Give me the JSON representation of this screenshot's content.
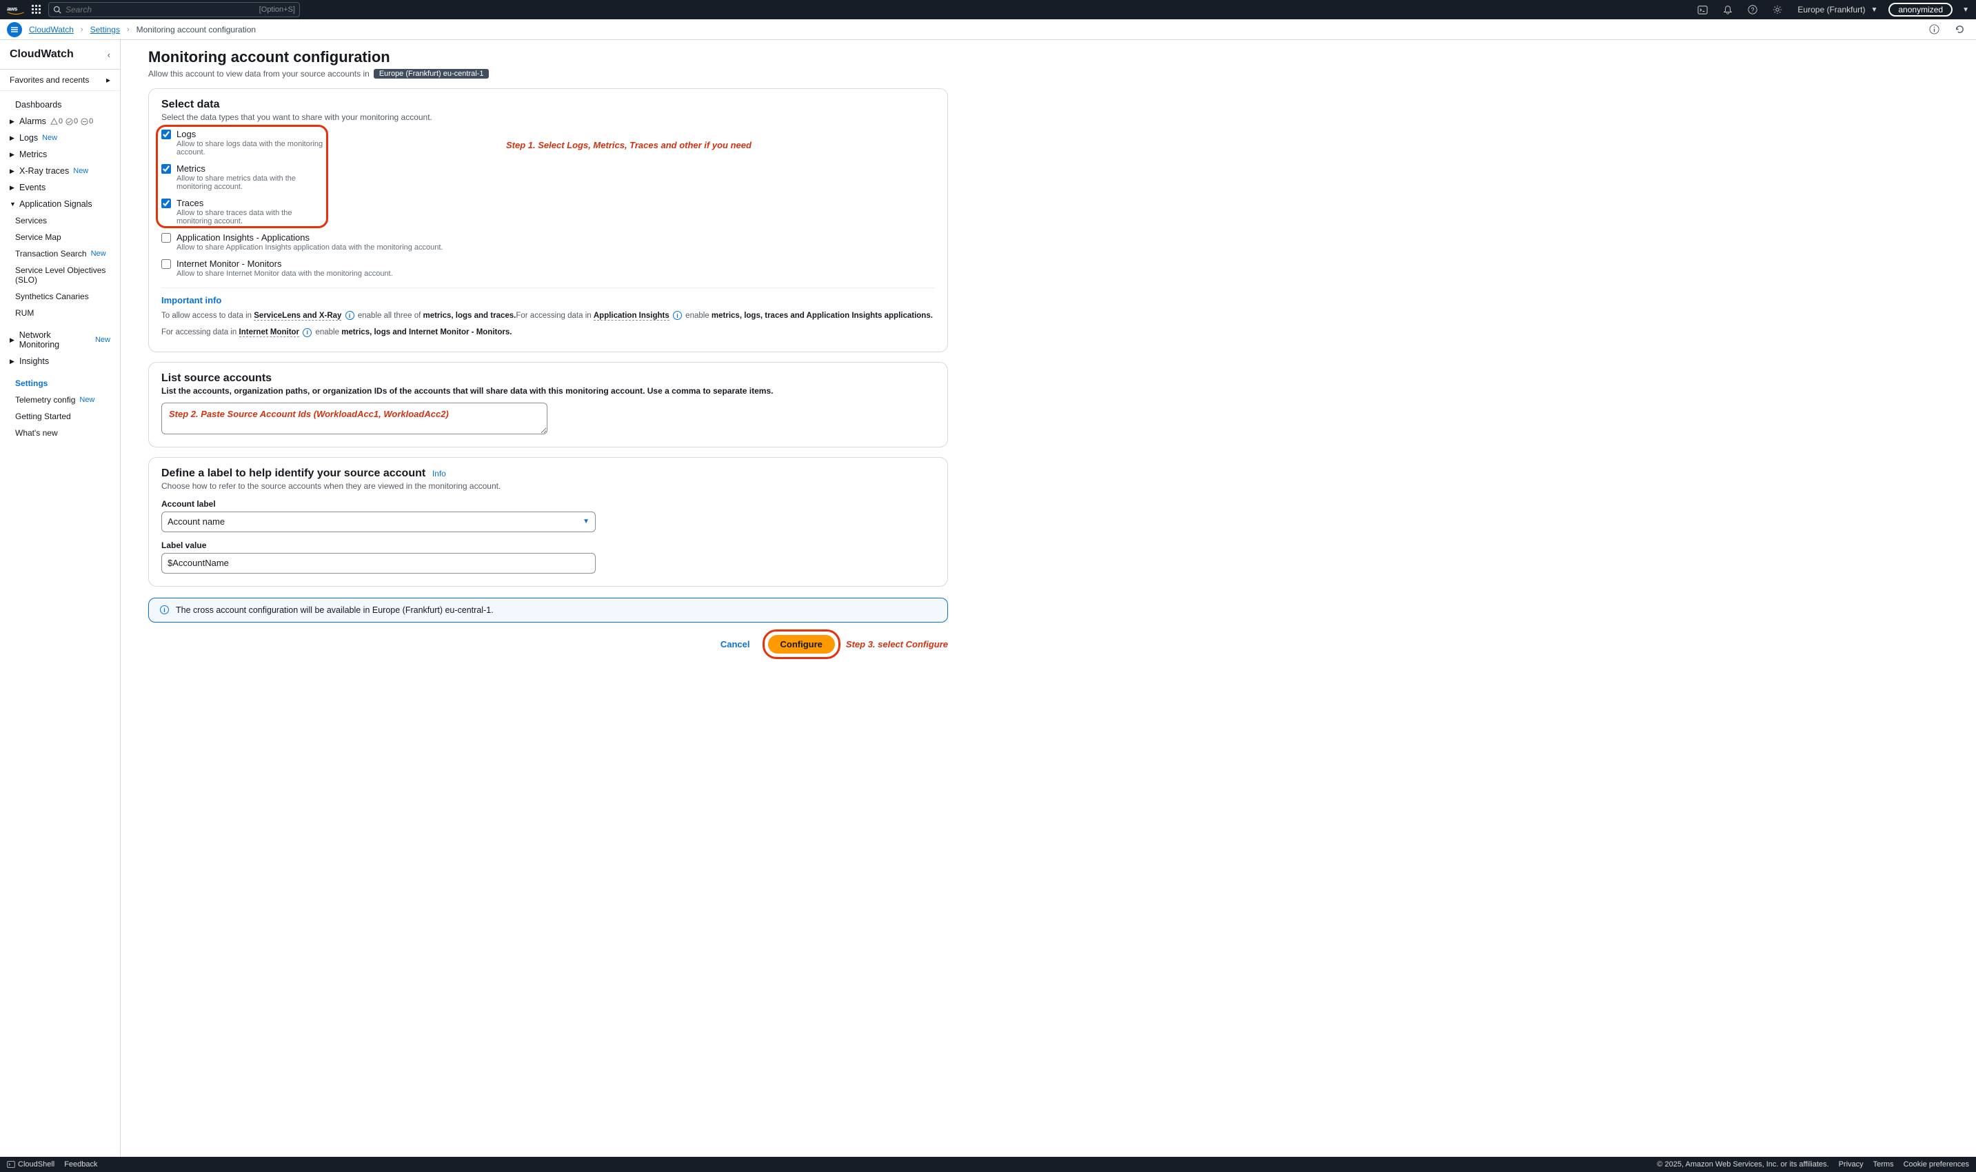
{
  "topnav": {
    "search_placeholder": "Search",
    "search_shortcut": "[Option+S]",
    "region": "Europe (Frankfurt)",
    "account": "anonymized"
  },
  "breadcrumb": {
    "items": [
      "CloudWatch",
      "Settings",
      "Monitoring account configuration"
    ]
  },
  "sidebar": {
    "title": "CloudWatch",
    "favorites": "Favorites and recents",
    "items": {
      "dashboards": "Dashboards",
      "alarms": "Alarms",
      "alarms_counts": [
        "0",
        "0",
        "0"
      ],
      "logs": "Logs",
      "metrics": "Metrics",
      "xray": "X-Ray traces",
      "events": "Events",
      "appsignals": "Application Signals",
      "services": "Services",
      "servicemap": "Service Map",
      "txnsearch": "Transaction Search",
      "slo": "Service Level Objectives (SLO)",
      "synthetics": "Synthetics Canaries",
      "rum": "RUM",
      "netmon": "Network Monitoring",
      "insights": "Insights",
      "settings": "Settings",
      "telemetry": "Telemetry config",
      "getstarted": "Getting Started",
      "whatsnew": "What's new"
    },
    "new_badge": "New"
  },
  "page": {
    "title": "Monitoring account configuration",
    "subtitle": "Allow this account to view data from your source accounts in",
    "region_chip": "Europe (Frankfurt) eu-central-1"
  },
  "select_data": {
    "title": "Select data",
    "subtitle": "Select the data types that you want to share with your monitoring account.",
    "options": [
      {
        "label": "Logs",
        "desc": "Allow to share logs data with the monitoring account.",
        "checked": true
      },
      {
        "label": "Metrics",
        "desc": "Allow to share metrics data with the monitoring account.",
        "checked": true
      },
      {
        "label": "Traces",
        "desc": "Allow to share traces data with the monitoring account.",
        "checked": true
      },
      {
        "label": "Application Insights - Applications",
        "desc": "Allow to share Application Insights application data with the monitoring account.",
        "checked": false
      },
      {
        "label": "Internet Monitor - Monitors",
        "desc": "Allow to share Internet Monitor data with the monitoring account.",
        "checked": false
      }
    ],
    "important": "Important info",
    "line1_a": "To allow access to data in ",
    "line1_b": "ServiceLens and X-Ray",
    "line1_c": " enable all three of ",
    "line1_d": "metrics, logs and traces.",
    "line1_e": "For accessing data in ",
    "line1_f": "Application Insights",
    "line1_g": " enable ",
    "line1_h": "metrics, logs, traces and Application Insights applications.",
    "line2_a": "For accessing data in ",
    "line2_b": "Internet Monitor",
    "line2_c": " enable ",
    "line2_d": "metrics, logs and Internet Monitor - Monitors."
  },
  "source_accounts": {
    "title": "List source accounts",
    "subtitle": "List the accounts, organization paths, or organization IDs of the accounts that will share data with this monitoring account. Use a comma to separate items.",
    "placeholder_annot": "Step 2. Paste Source Account Ids (WorkloadAcc1, WorkloadAcc2)"
  },
  "label_panel": {
    "title": "Define a label to help identify your source account",
    "info": "Info",
    "subtitle": "Choose how to refer to the source accounts when they are viewed in the monitoring account.",
    "field1": "Account label",
    "field1_value": "Account name",
    "field2": "Label value",
    "field2_value": "$AccountName"
  },
  "alert": "The cross account configuration will be available in Europe (Frankfurt) eu-central-1.",
  "actions": {
    "cancel": "Cancel",
    "configure": "Configure"
  },
  "annotations": {
    "step1": "Step 1. Select Logs, Metrics, Traces and other if you need",
    "step3": "Step 3. select Configure"
  },
  "footer": {
    "cloudshell": "CloudShell",
    "feedback": "Feedback",
    "copyright": "© 2025, Amazon Web Services, Inc. or its affiliates.",
    "privacy": "Privacy",
    "terms": "Terms",
    "cookies": "Cookie preferences"
  }
}
